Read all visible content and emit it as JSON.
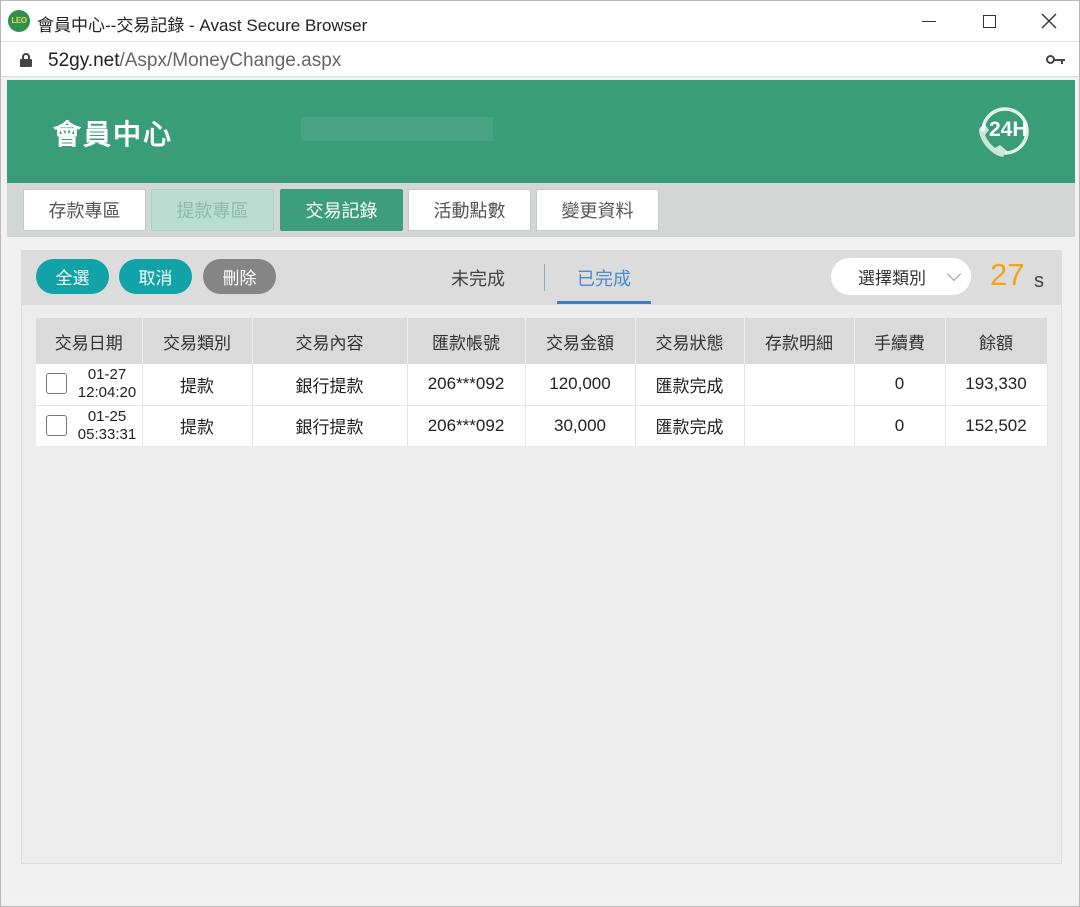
{
  "window": {
    "title": "會員中心--交易記錄 - Avast Secure Browser",
    "app_icon_text": "LEO"
  },
  "address_bar": {
    "domain": "52gy.net",
    "path": "/Aspx/MoneyChange.aspx"
  },
  "header": {
    "title": "會員中心",
    "badge": "24H",
    "brand_color": "#3a9d7a"
  },
  "tabs": [
    {
      "label": "存款專區",
      "state": "normal"
    },
    {
      "label": "提款專區",
      "state": "disabled"
    },
    {
      "label": "交易記錄",
      "state": "active"
    },
    {
      "label": "活動點數",
      "state": "normal"
    },
    {
      "label": "變更資料",
      "state": "normal"
    }
  ],
  "toolbar": {
    "select_all": "全選",
    "cancel": "取消",
    "delete": "刪除",
    "subtab_pending": "未完成",
    "subtab_done": "已完成",
    "active_subtab": "已完成",
    "category_select": "選擇類別",
    "countdown": "27",
    "countdown_unit": "s"
  },
  "table": {
    "columns": [
      "交易日期",
      "交易類別",
      "交易內容",
      "匯款帳號",
      "交易金額",
      "交易狀態",
      "存款明細",
      "手續費",
      "餘額"
    ],
    "rows": [
      {
        "date": "01-27",
        "time": "12:04:20",
        "type": "提款",
        "content": "銀行提款",
        "account": "206***092",
        "amount": "120,000",
        "status": "匯款完成",
        "deposit_detail": "",
        "fee": "0",
        "balance": "193,330",
        "checked": false
      },
      {
        "date": "01-25",
        "time": "05:33:31",
        "type": "提款",
        "content": "銀行提款",
        "account": "206***092",
        "amount": "30,000",
        "status": "匯款完成",
        "deposit_detail": "",
        "fee": "0",
        "balance": "152,502",
        "checked": false
      }
    ]
  },
  "colors": {
    "teal_button": "#12a3a8",
    "amount_red": "#e0322e",
    "status_blue": "#3d55c8",
    "balance_green": "#1e8c44",
    "countdown_orange": "#f5a21b"
  }
}
